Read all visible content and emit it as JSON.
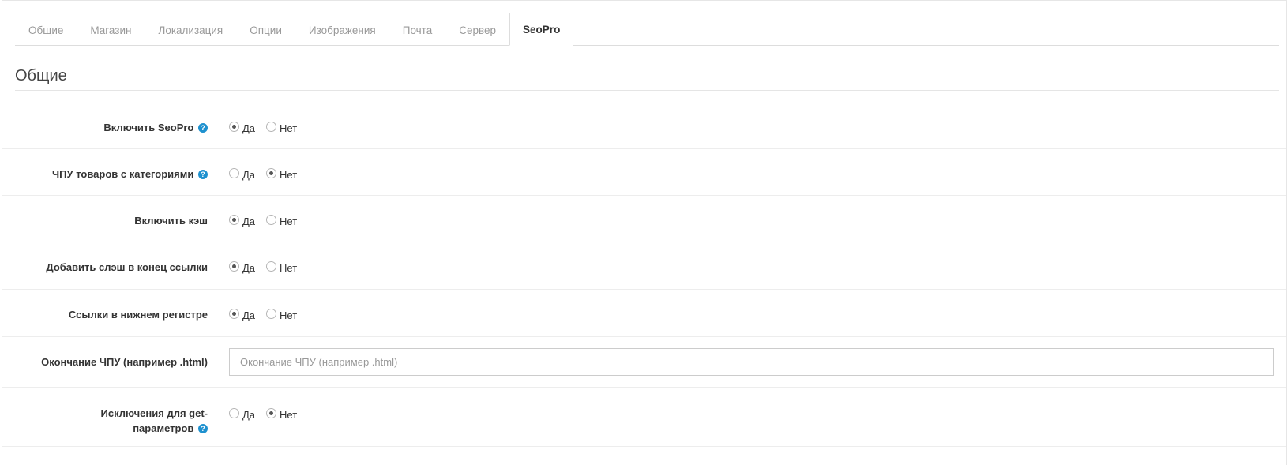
{
  "tabs": [
    {
      "label": "Общие",
      "active": false
    },
    {
      "label": "Магазин",
      "active": false
    },
    {
      "label": "Локализация",
      "active": false
    },
    {
      "label": "Опции",
      "active": false
    },
    {
      "label": "Изображения",
      "active": false
    },
    {
      "label": "Почта",
      "active": false
    },
    {
      "label": "Сервер",
      "active": false
    },
    {
      "label": "SeoPro",
      "active": true
    }
  ],
  "section": {
    "title": "Общие"
  },
  "radio_labels": {
    "yes": "Да",
    "no": "Нет"
  },
  "help_glyph": "?",
  "settings": {
    "enable_seopro": {
      "label": "Включить SeoPro",
      "value": "yes",
      "help": true
    },
    "product_url_with_categories": {
      "label": "ЧПУ товаров с категориями",
      "value": "no",
      "help": true
    },
    "enable_cache": {
      "label": "Включить кэш",
      "value": "yes",
      "help": false
    },
    "trailing_slash": {
      "label": "Добавить слэш в конец ссылки",
      "value": "yes",
      "help": false
    },
    "lowercase_links": {
      "label": "Ссылки в нижнем регистре",
      "value": "yes",
      "help": false
    },
    "url_postfix": {
      "label": "Окончание ЧПУ (например .html)",
      "value": "",
      "placeholder": "Окончание ЧПУ (например .html)"
    },
    "get_exceptions": {
      "label_line1": "Исключения для get-",
      "label_line2": "параметров",
      "value": "no",
      "help": true
    }
  },
  "colors": {
    "help_badge": "#1e91cf",
    "active_tab_text": "#333333",
    "inactive_tab_text": "#999999"
  }
}
